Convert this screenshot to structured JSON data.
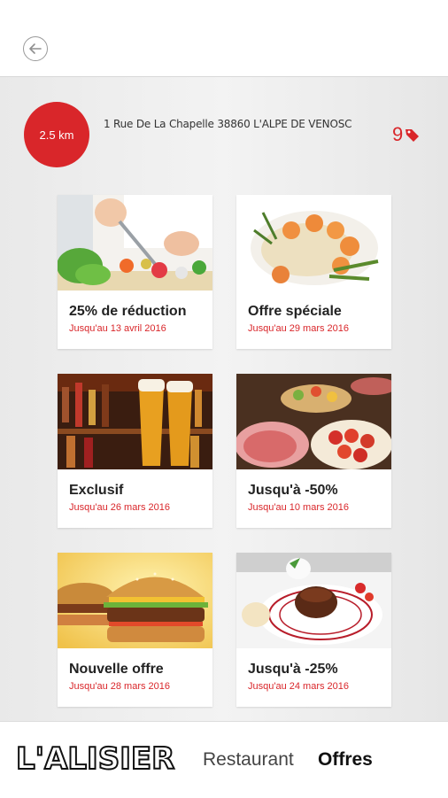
{
  "header": {
    "back_icon": "arrow-left-icon"
  },
  "location": {
    "distance": "2.5 km",
    "address": "1 Rue De La Chapelle 38860 L'ALPE DE VENOSC",
    "offer_count": "9",
    "offer_icon": "tag-icon"
  },
  "offers": [
    {
      "title": "25% de réduction",
      "date": "Jusqu'au 13 avril 2016",
      "image": "cooking-vegetables"
    },
    {
      "title": "Offre spéciale",
      "date": "Jusqu'au 29 mars 2016",
      "image": "risotto-shrimp"
    },
    {
      "title": "Exclusif",
      "date": "Jusqu'au 26 mars 2016",
      "image": "beer-glasses"
    },
    {
      "title": "Jusqu'à -50%",
      "date": "Jusqu'au 10 mars 2016",
      "image": "buffet-platters"
    },
    {
      "title": "Nouvelle offre",
      "date": "Jusqu'au 28 mars 2016",
      "image": "burger"
    },
    {
      "title": "Jusqu'à -25%",
      "date": "Jusqu'au 24 mars 2016",
      "image": "chocolate-dessert"
    }
  ],
  "bottom_nav": {
    "brand": "L'ALISIER",
    "tab_restaurant": "Restaurant",
    "tab_offres": "Offres",
    "active_tab": "Offres"
  },
  "colors": {
    "accent": "#d9262a",
    "background": "#ececec"
  }
}
